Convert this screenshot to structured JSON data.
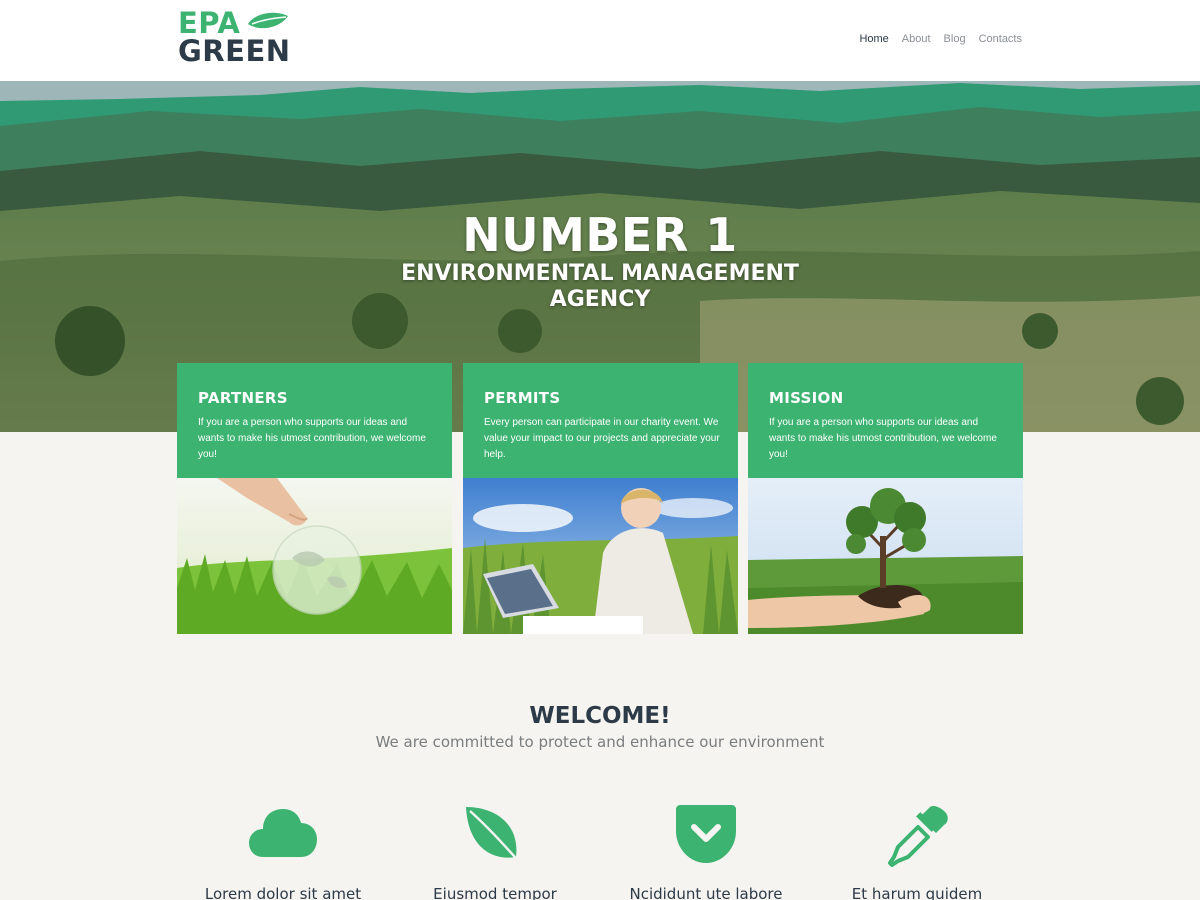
{
  "header": {
    "logo_line1": "EPA",
    "logo_line2": "GREEN",
    "nav": [
      "Home",
      "About",
      "Blog",
      "Contacts"
    ],
    "active_nav": "Home"
  },
  "hero": {
    "title": "NUMBER 1",
    "subtitle_line1": "ENVIRONMENTAL MANAGEMENT",
    "subtitle_line2": "AGENCY"
  },
  "cards": [
    {
      "title": "PARTNERS",
      "text": "If you are a person who supports our ideas and wants to make his utmost contribution, we welcome you!",
      "image": "glass-globe-on-grass"
    },
    {
      "title": "PERMITS",
      "text": "Every person can participate in our charity event. We value your impact to our projects and appreciate your help.",
      "image": "woman-with-laptop-in-field"
    },
    {
      "title": "MISSION",
      "text": "If you are a person who supports our ideas and wants to make his utmost contribution, we welcome you!",
      "image": "hands-holding-tree"
    }
  ],
  "welcome": {
    "title": "WELCOME!",
    "tagline": "We are committed to protect and enhance our environment"
  },
  "features": [
    {
      "icon": "cloud-icon",
      "label": "Lorem dolor sit amet"
    },
    {
      "icon": "leaf-icon",
      "label": "Eiusmod tempor"
    },
    {
      "icon": "pocket-icon",
      "label": "Ncididunt ute labore"
    },
    {
      "icon": "eyedropper-icon",
      "label": "Et harum quidem"
    }
  ],
  "colors": {
    "accent": "#3cb371",
    "dark": "#2d3a48",
    "muted": "#7a7d80",
    "section_bg": "#f5f4f0"
  }
}
